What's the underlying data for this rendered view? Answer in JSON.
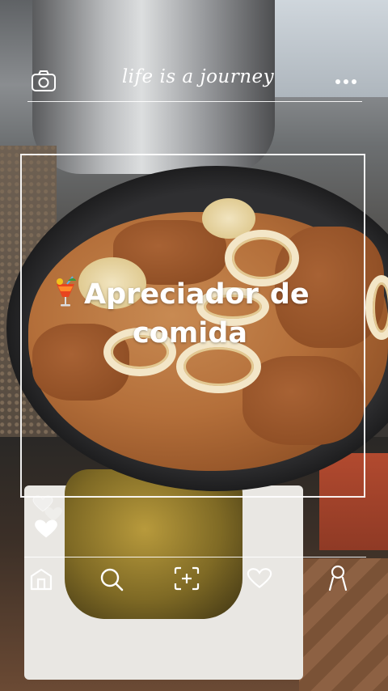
{
  "header": {
    "tagline": "life is a journey",
    "camera_icon": "camera-icon",
    "more_icon": "more-dots-icon"
  },
  "post": {
    "caption_line1_word1": "Apreciador",
    "caption_line1_word2": "de",
    "caption_line2": "comida",
    "caption_emoji_icon": "tropical-drink-icon"
  },
  "reactions": {
    "like_icon": "heart-filled-icon",
    "floating_icons": [
      "heart-outline-icon",
      "heart-outline-icon"
    ]
  },
  "bottom_nav": {
    "items": [
      {
        "icon": "home-icon"
      },
      {
        "icon": "search-icon"
      },
      {
        "icon": "add-post-icon"
      },
      {
        "icon": "heart-outline-icon"
      },
      {
        "icon": "profile-icon"
      }
    ]
  },
  "colors": {
    "overlay": "#ffffff",
    "background": "#3a3633"
  }
}
